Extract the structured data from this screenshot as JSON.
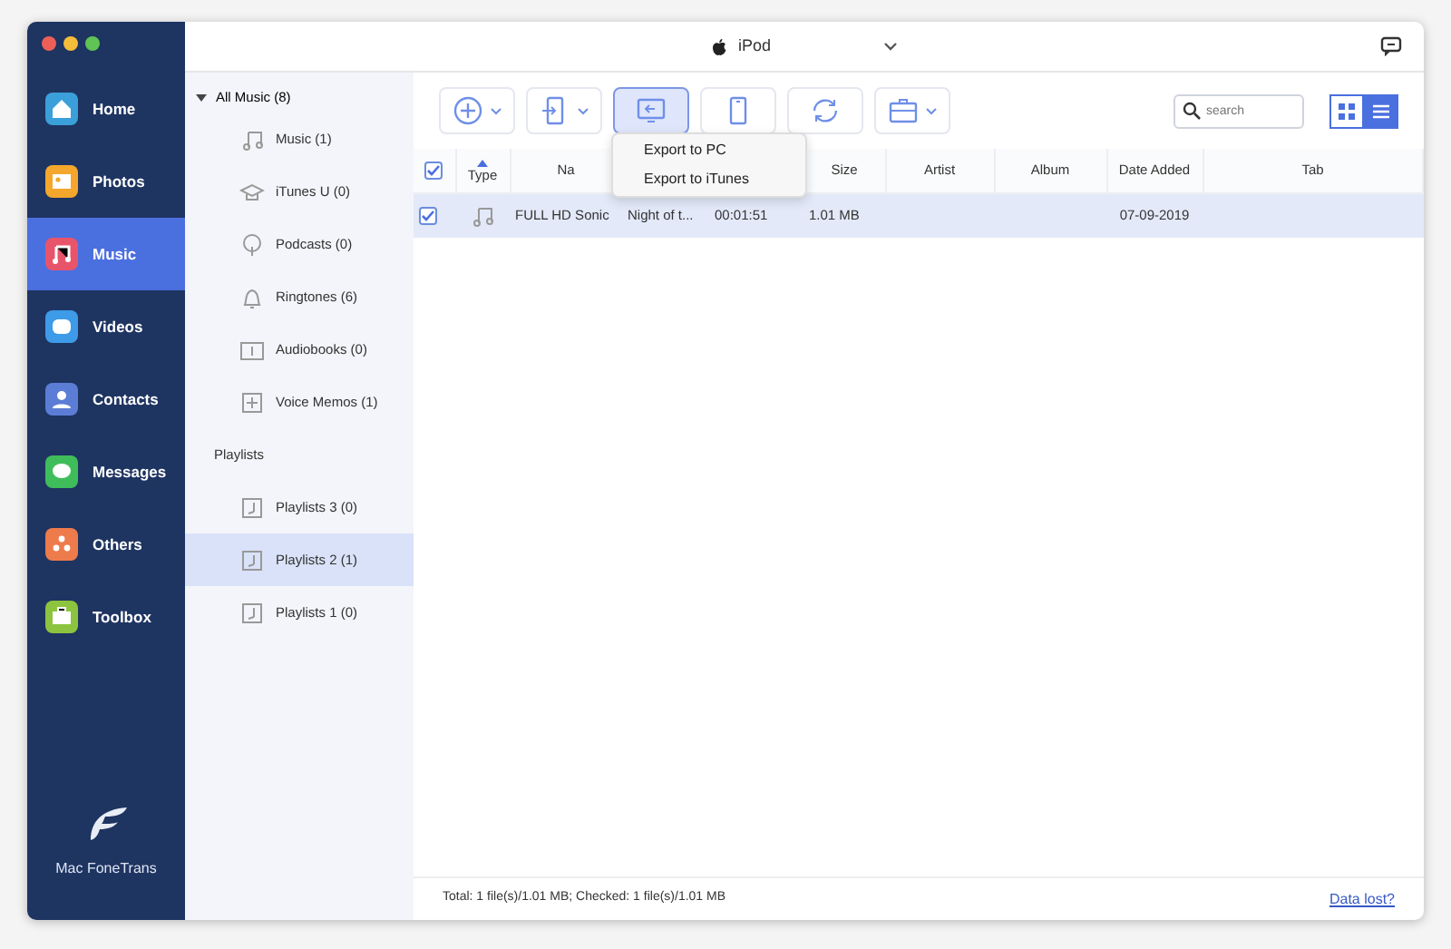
{
  "window": {
    "title": "iPod"
  },
  "nav": {
    "items": [
      {
        "kind": "home",
        "label": "Home",
        "color": "#3b9fd9",
        "selected": false
      },
      {
        "kind": "photos",
        "label": "Photos",
        "color": "#f4a72c",
        "selected": false
      },
      {
        "kind": "music",
        "label": "Music",
        "color": "#e8556b",
        "selected": true
      },
      {
        "kind": "videos",
        "label": "Videos",
        "color": "#3e9be8",
        "selected": false
      },
      {
        "kind": "contacts",
        "label": "Contacts",
        "color": "#5c7dd6",
        "selected": false
      },
      {
        "kind": "messages",
        "label": "Messages",
        "color": "#3fbd5b",
        "selected": false
      },
      {
        "kind": "others",
        "label": "Others",
        "color": "#ee7b4b",
        "selected": false
      },
      {
        "kind": "toolbox",
        "label": "Toolbox",
        "color": "#8cc43f",
        "selected": false
      }
    ],
    "brand": "Mac FoneTrans"
  },
  "categories": {
    "group": {
      "label": "All Music (8)",
      "expanded": true,
      "children": [
        {
          "kind": "music",
          "label": "Music (1)",
          "selected": false
        },
        {
          "kind": "itunesu",
          "label": "iTunes U (0)",
          "selected": false
        },
        {
          "kind": "podcast",
          "label": "Podcasts (0)",
          "selected": false
        },
        {
          "kind": "ringtone",
          "label": "Ringtones (6)",
          "selected": false
        },
        {
          "kind": "audiobook",
          "label": "Audiobooks (0)",
          "selected": false
        },
        {
          "kind": "voicememo",
          "label": "Voice Memos (1)",
          "selected": false
        }
      ]
    },
    "playlists_heading": "Playlists",
    "playlists": [
      {
        "label": "Playlists 3 (0)",
        "selected": false
      },
      {
        "label": "Playlists 2 (1)",
        "selected": true
      },
      {
        "label": "Playlists 1 (0)",
        "selected": false
      }
    ]
  },
  "toolbar": {
    "buttons": [
      {
        "kind": "add",
        "has_menu": true,
        "selected": false
      },
      {
        "kind": "to-device",
        "has_menu": true,
        "selected": false
      },
      {
        "kind": "to-pc",
        "has_menu": false,
        "selected": true
      },
      {
        "kind": "phone",
        "has_menu": false,
        "selected": false
      },
      {
        "kind": "sync",
        "has_menu": false,
        "selected": false
      },
      {
        "kind": "toolbox",
        "has_menu": true,
        "selected": false
      }
    ],
    "menu": [
      "Export to PC",
      "Export to iTunes"
    ],
    "search": {
      "placeholder": "search"
    },
    "views": [
      {
        "kind": "grid",
        "selected": false
      },
      {
        "kind": "list",
        "selected": true
      }
    ]
  },
  "table": {
    "header_checked": true,
    "type_label": "Type",
    "type_sorted": true,
    "columns": [
      "Na",
      null,
      null,
      "Size",
      "Artist",
      "Album",
      "Date Added",
      "Tab"
    ],
    "rows": [
      {
        "checked": true,
        "selected": true,
        "kind": "music",
        "cells": [
          "FULL HD Sonic",
          "Night of t...",
          "00:01:51",
          "1.01 MB",
          null,
          null,
          "07-09-2019",
          null
        ]
      }
    ]
  },
  "status_bar": {
    "summary": "Total: 1 file(s)/1.01 MB; Checked: 1 file(s)/1.01 MB",
    "link": "Data lost?"
  }
}
